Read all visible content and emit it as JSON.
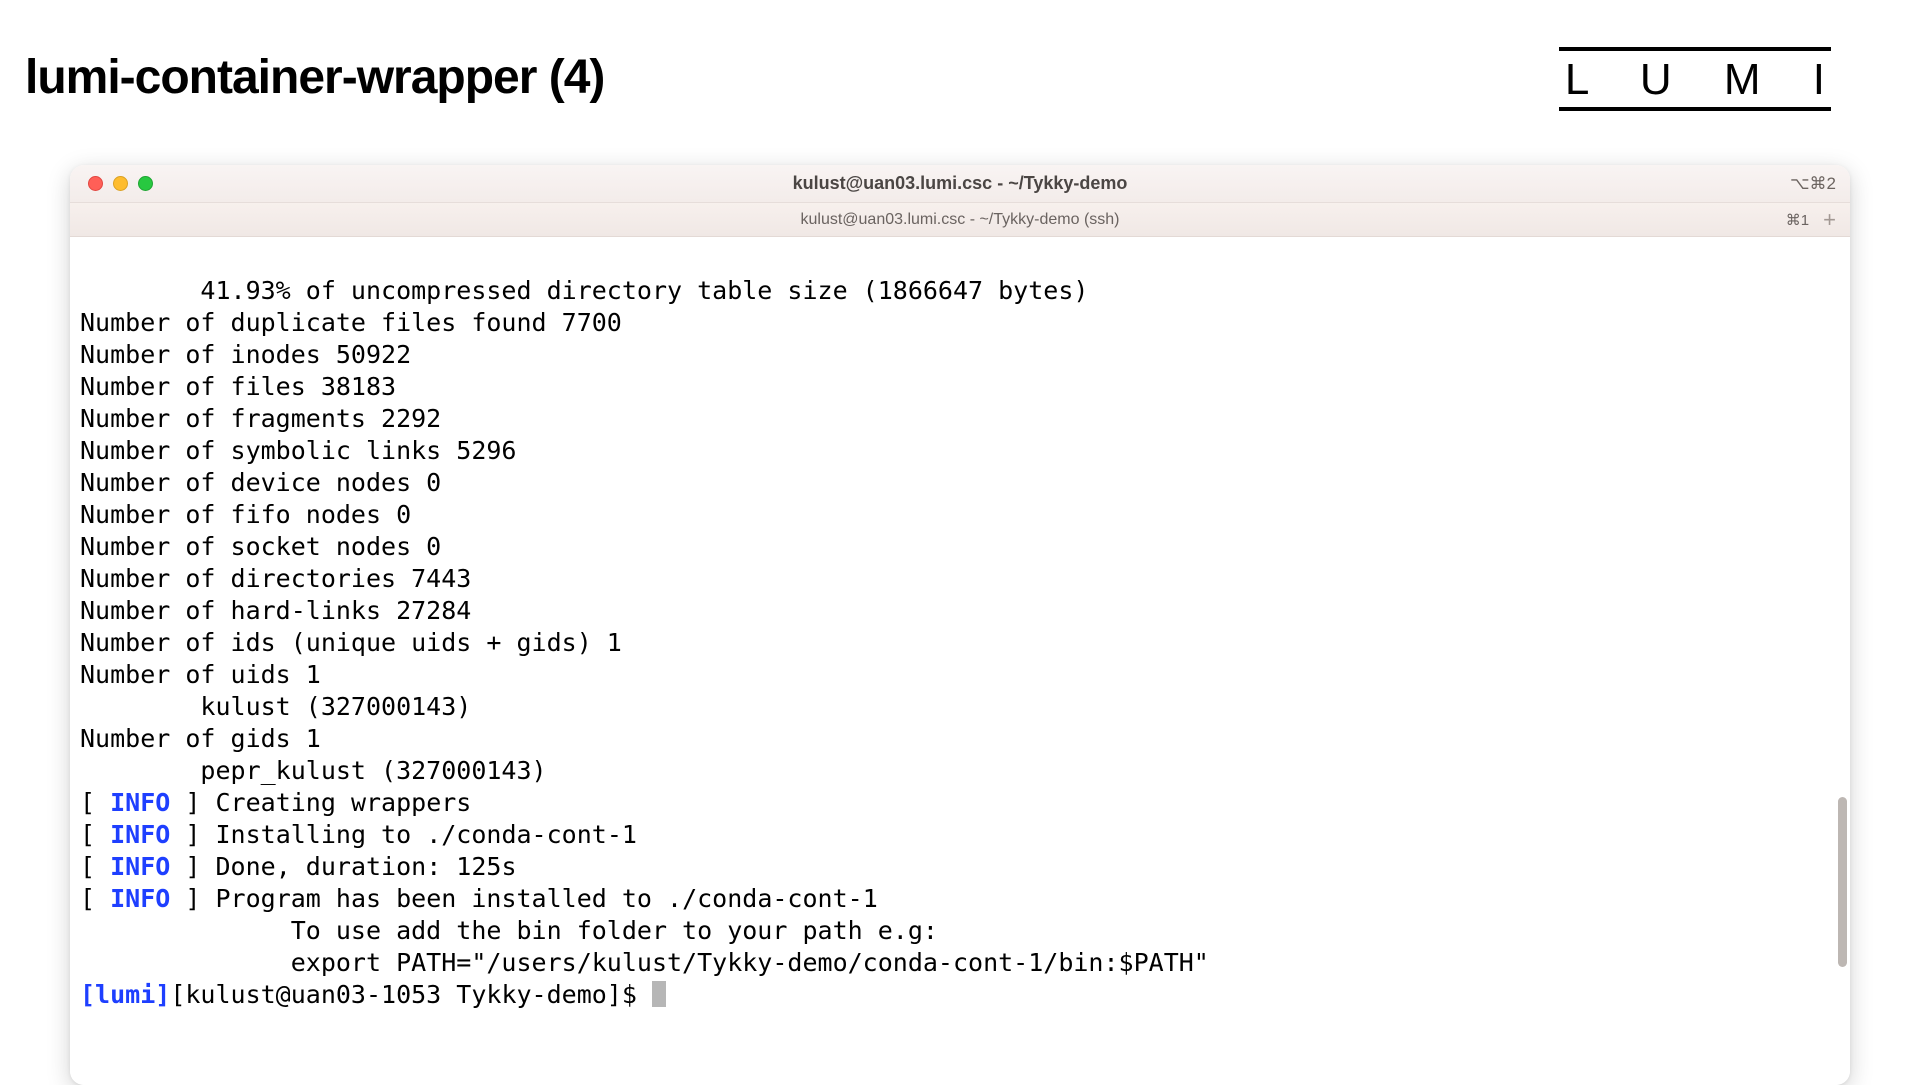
{
  "slide": {
    "title": "lumi-container-wrapper (4)",
    "logo_text": "L U M I"
  },
  "window": {
    "titlebar_title": "kulust@uan03.lumi.csc - ~/Tykky-demo",
    "titlebar_right": "⌥⌘2",
    "tab_title": "kulust@uan03.lumi.csc - ~/Tykky-demo (ssh)",
    "tab_right": "⌘1",
    "tab_plus": "+"
  },
  "term": {
    "line01": "        41.93% of uncompressed directory table size (1866647 bytes)",
    "line02": "Number of duplicate files found 7700",
    "line03": "Number of inodes 50922",
    "line04": "Number of files 38183",
    "line05": "Number of fragments 2292",
    "line06": "Number of symbolic links 5296",
    "line07": "Number of device nodes 0",
    "line08": "Number of fifo nodes 0",
    "line09": "Number of socket nodes 0",
    "line10": "Number of directories 7443",
    "line11": "Number of hard-links 27284",
    "line12": "Number of ids (unique uids + gids) 1",
    "line13": "Number of uids 1",
    "line14": "        kulust (327000143)",
    "line15": "Number of gids 1",
    "line16": "        pepr_kulust (327000143)",
    "info_label": "INFO",
    "info1_msg": "Creating wrappers",
    "info2_msg": "Installing to ./conda-cont-1",
    "info3_msg": "Done, duration: 125s",
    "info4_msg": "Program has been installed to ./conda-cont-1",
    "info4_sub1": "              To use add the bin folder to your path e.g:",
    "info4_sub2": "              export PATH=\"/users/kulust/Tykky-demo/conda-cont-1/bin:$PATH\"",
    "prompt_lumi": "[lumi]",
    "prompt_rest": "[kulust@uan03-1053 Tykky-demo]$ "
  }
}
